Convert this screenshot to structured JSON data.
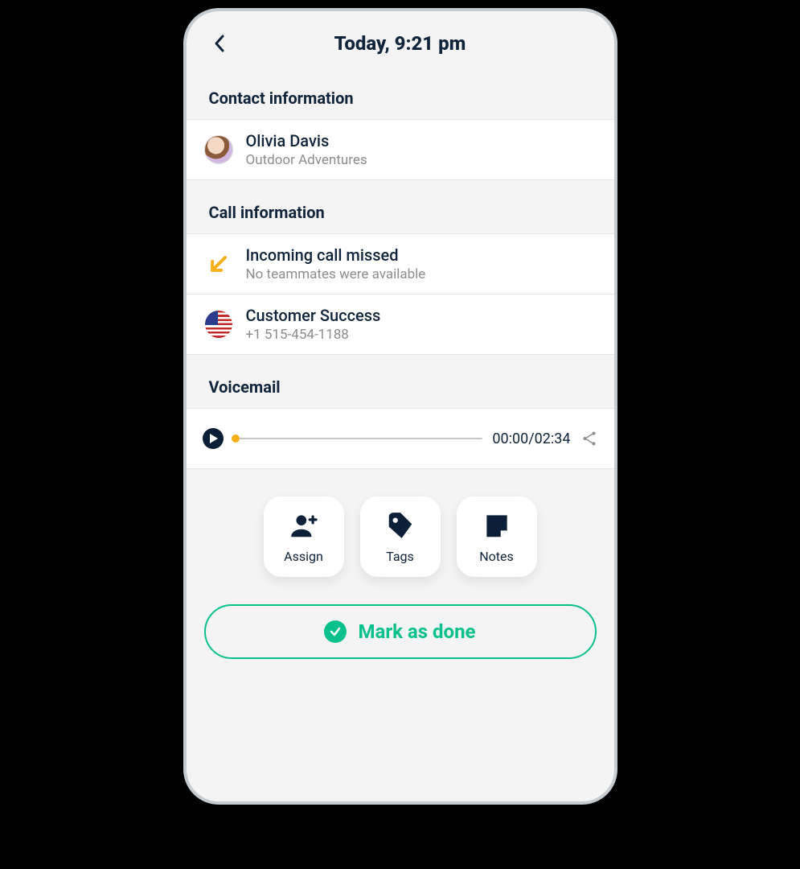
{
  "header": {
    "title": "Today, 9:21 pm"
  },
  "sections": {
    "contact_label": "Contact information",
    "call_label": "Call information",
    "voicemail_label": "Voicemail"
  },
  "contact": {
    "name": "Olivia Davis",
    "company": "Outdoor Adventures"
  },
  "call": {
    "status_title": "Incoming call missed",
    "status_sub": "No teammates were available",
    "dept": "Customer Success",
    "phone": "+1 515-454-1188"
  },
  "voicemail": {
    "time_display": "00:00/02:34"
  },
  "actions": {
    "assign": "Assign",
    "tags": "Tags",
    "notes": "Notes"
  },
  "done_button": "Mark as done",
  "colors": {
    "accent_green": "#08c08b",
    "dark": "#0b2038",
    "amber": "#f5b01a"
  }
}
